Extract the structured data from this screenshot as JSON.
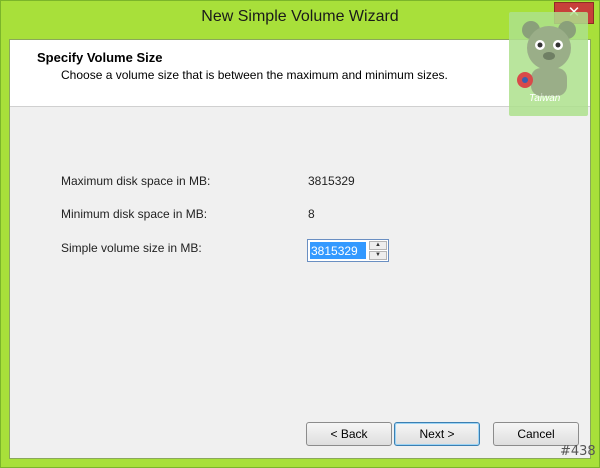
{
  "window": {
    "title": "New Simple Volume Wizard",
    "close_glyph": "✕"
  },
  "header": {
    "title": "Specify Volume Size",
    "subtitle": "Choose a volume size that is between the maximum and minimum sizes."
  },
  "fields": {
    "max_label": "Maximum disk space in MB:",
    "max_value": "3815329",
    "min_label": "Minimum disk space in MB:",
    "min_value": "8",
    "size_label": "Simple volume size in MB:",
    "size_value": "3815329",
    "spin_up": "▲",
    "spin_down": "▼"
  },
  "buttons": {
    "back": "< Back",
    "next": "Next >",
    "cancel": "Cancel"
  },
  "overlay": {
    "watermark_text": "Taiwan",
    "corner_tag": "#438"
  },
  "colors": {
    "window_frame": "#a8e03a",
    "selection": "#3399ff"
  }
}
